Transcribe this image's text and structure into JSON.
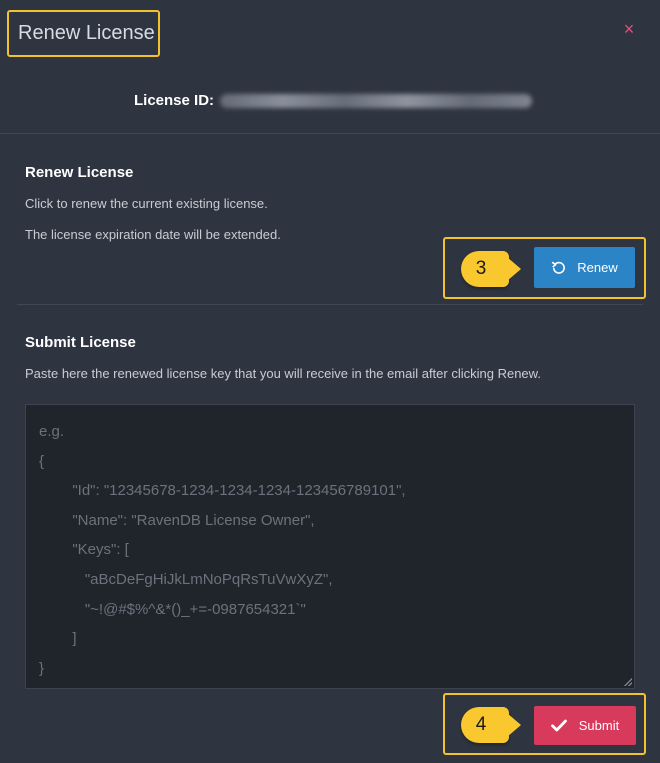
{
  "dialog": {
    "title": "Renew License",
    "close_label": "×",
    "license_id_label": "License ID:"
  },
  "renew_section": {
    "title": "Renew License",
    "desc_1": "Click to renew the current existing license.",
    "desc_2": "The license expiration date will be extended.",
    "step_badge": "3",
    "button_label": "Renew",
    "button_icon": "refresh-icon",
    "button_color": "#2b84c6"
  },
  "submit_section": {
    "title": "Submit License",
    "desc": "Paste here the renewed license key that you will receive in the email after clicking Renew.",
    "placeholder": "e.g.\n{\n        \"Id\": \"12345678-1234-1234-1234-123456789101\",\n        \"Name\": \"RavenDB License Owner\",\n        \"Keys\": [\n           \"aBcDeFgHiJkLmNoPqRsTuVwXyZ\",\n           \"~!@#$%^&*()_+=-0987654321`\"\n        ]\n}",
    "step_badge": "4",
    "button_label": "Submit",
    "button_icon": "check-icon",
    "button_color": "#d83a5c"
  },
  "highlight_color": "#f3c12d"
}
